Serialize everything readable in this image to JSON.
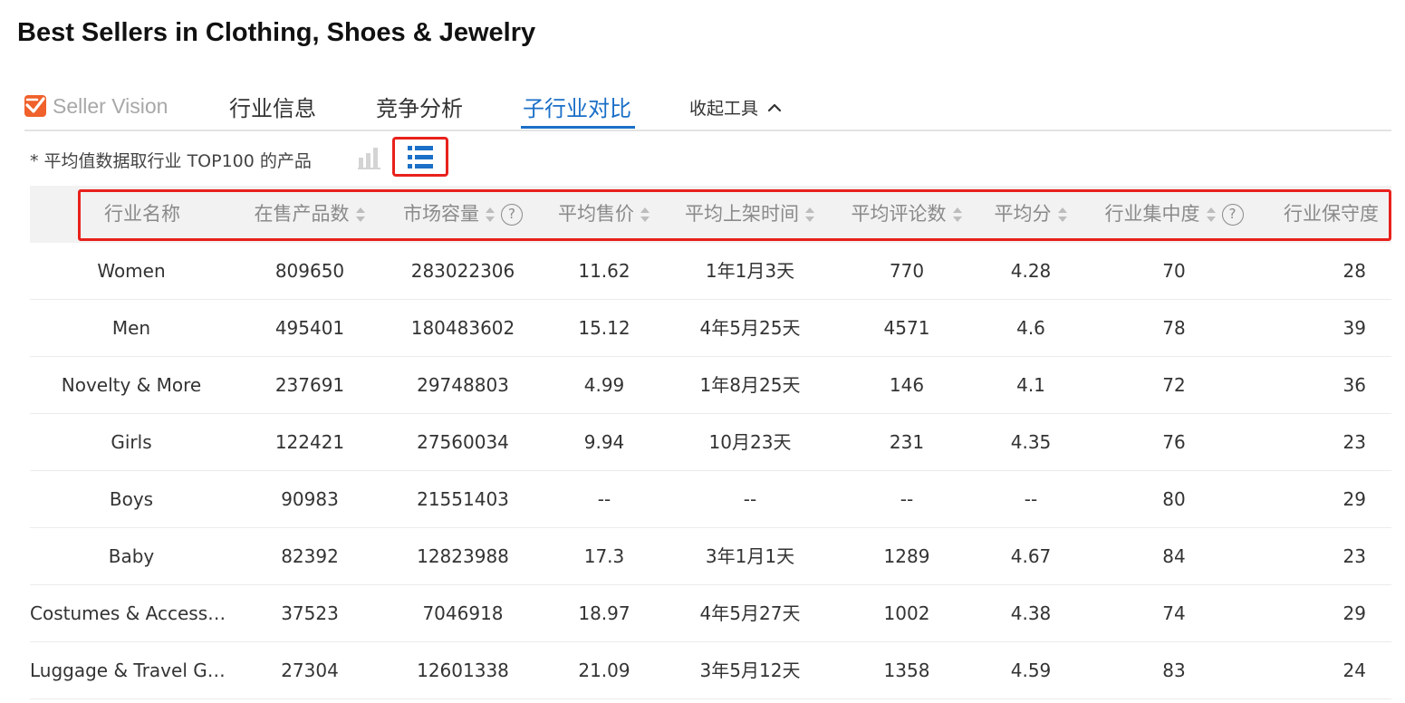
{
  "page": {
    "title": "Best Sellers in Clothing, Shoes & Jewelry"
  },
  "tabs": {
    "brand": "Seller Vision",
    "items": [
      {
        "label": "行业信息"
      },
      {
        "label": "竞争分析"
      },
      {
        "label": "子行业对比"
      }
    ],
    "active_index": 2,
    "collapse_label": "收起工具"
  },
  "note": "* 平均值数据取行业 TOP100 的产品",
  "view_mode": "list",
  "colors": {
    "accent": "#1a6fc7",
    "highlight": "#e8211c",
    "brand": "#f0612b"
  },
  "table": {
    "columns": [
      {
        "label": "行业名称",
        "sortable": false,
        "help": false
      },
      {
        "label": "在售产品数",
        "sortable": true,
        "help": false
      },
      {
        "label": "市场容量",
        "sortable": true,
        "help": true
      },
      {
        "label": "平均售价",
        "sortable": true,
        "help": false
      },
      {
        "label": "平均上架时间",
        "sortable": true,
        "help": false
      },
      {
        "label": "平均评论数",
        "sortable": true,
        "help": false
      },
      {
        "label": "平均分",
        "sortable": true,
        "help": false
      },
      {
        "label": "行业集中度",
        "sortable": true,
        "help": true
      },
      {
        "label": "行业保守度",
        "sortable": false,
        "help": false
      }
    ],
    "help_glyph": "?",
    "rows": [
      [
        "Women",
        "809650",
        "283022306",
        "11.62",
        "1年1月3天",
        "770",
        "4.28",
        "70",
        "28"
      ],
      [
        "Men",
        "495401",
        "180483602",
        "15.12",
        "4年5月25天",
        "4571",
        "4.6",
        "78",
        "39"
      ],
      [
        "Novelty & More",
        "237691",
        "29748803",
        "4.99",
        "1年8月25天",
        "146",
        "4.1",
        "72",
        "36"
      ],
      [
        "Girls",
        "122421",
        "27560034",
        "9.94",
        "10月23天",
        "231",
        "4.35",
        "76",
        "23"
      ],
      [
        "Boys",
        "90983",
        "21551403",
        "--",
        "--",
        "--",
        "--",
        "80",
        "29"
      ],
      [
        "Baby",
        "82392",
        "12823988",
        "17.3",
        "3年1月1天",
        "1289",
        "4.67",
        "84",
        "23"
      ],
      [
        "Costumes & Accessor…",
        "37523",
        "7046918",
        "18.97",
        "4年5月27天",
        "1002",
        "4.38",
        "74",
        "29"
      ],
      [
        "Luggage & Travel Gear",
        "27304",
        "12601338",
        "21.09",
        "3年5月12天",
        "1358",
        "4.59",
        "83",
        "24"
      ]
    ]
  }
}
